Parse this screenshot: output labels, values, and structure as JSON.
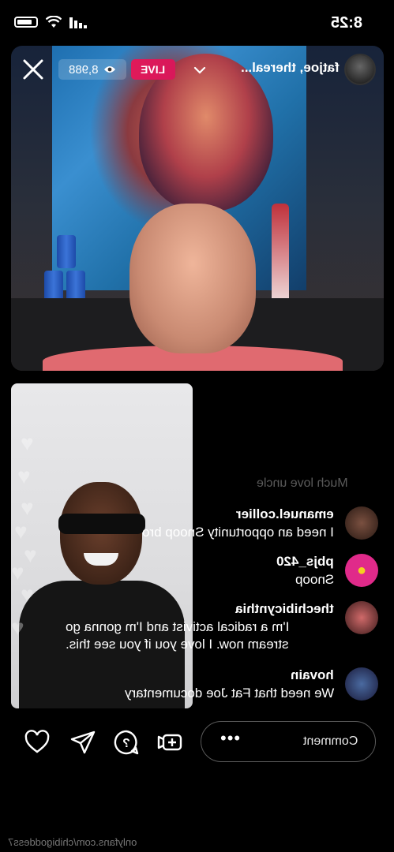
{
  "status_bar": {
    "time": "8:25"
  },
  "header": {
    "close_icon": "close-icon",
    "viewer_count": "8,988",
    "live_label": "LIVE",
    "host_name": "fatjoe, thereal..."
  },
  "comments": {
    "faded": "Much love uncle",
    "items": [
      {
        "user": "emanuel.collier",
        "text": "I need an opportunity Snoop bro"
      },
      {
        "user": "pbjs_420",
        "text": "Snoop"
      },
      {
        "user": "thechibicynthia",
        "text": "I'm a radical activist and I'm gonna go stream now. I love you if you see this."
      },
      {
        "user": "hovain",
        "text": "We need that Fat Joe documentary"
      }
    ]
  },
  "toolbar": {
    "comment_placeholder": "Comment",
    "more_label": "•••"
  },
  "watermark": "onlyfans.com/chibigoddess7",
  "colors": {
    "live": "#e01a5a",
    "background": "#000000"
  }
}
